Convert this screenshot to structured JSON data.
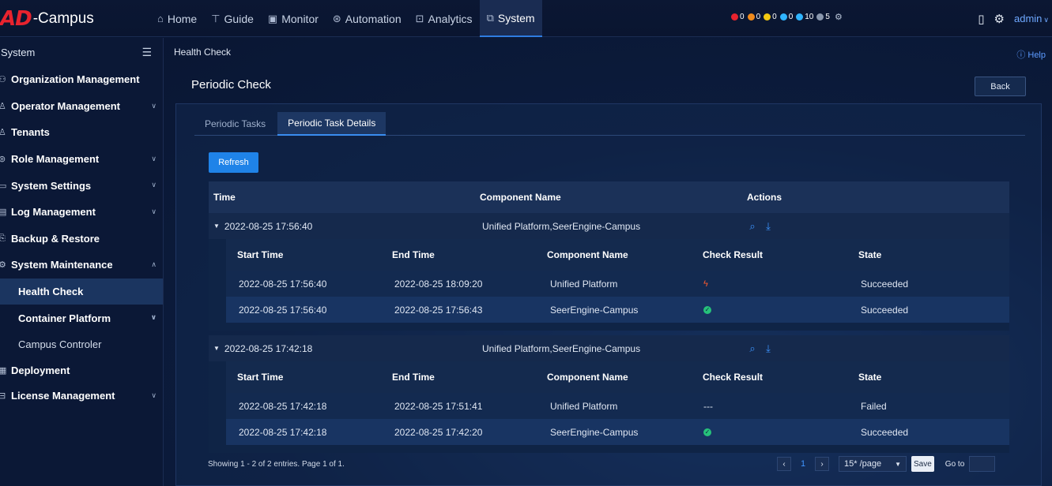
{
  "app": {
    "logo_ad": "AD",
    "logo_campus": "-Campus"
  },
  "nav": [
    {
      "label": "Home",
      "icon": "home-icon"
    },
    {
      "label": "Guide",
      "icon": "guide-icon"
    },
    {
      "label": "Monitor",
      "icon": "monitor-icon"
    },
    {
      "label": "Automation",
      "icon": "automation-icon"
    },
    {
      "label": "Analytics",
      "icon": "analytics-icon"
    },
    {
      "label": "System",
      "icon": "system-icon",
      "active": true
    }
  ],
  "alarms": [
    {
      "color": "#e8232e",
      "value": "0"
    },
    {
      "color": "#f08a1c",
      "value": "0"
    },
    {
      "color": "#f2c811",
      "value": "0"
    },
    {
      "color": "#2fb4ff",
      "value": "0"
    },
    {
      "color": "#2fb4ff",
      "value": "10"
    },
    {
      "color": "#8a97ad",
      "value": "5"
    }
  ],
  "user": {
    "name": "admin"
  },
  "sidebar": {
    "header": "System",
    "items": [
      {
        "label": "Organization Management"
      },
      {
        "label": "Operator Management"
      },
      {
        "label": "Tenants"
      },
      {
        "label": "Role Management"
      },
      {
        "label": "System Settings"
      },
      {
        "label": "Log Management"
      },
      {
        "label": "Backup & Restore"
      },
      {
        "label": "System Maintenance"
      }
    ],
    "sub_items": [
      {
        "label": "Health Check"
      },
      {
        "label": "Container Platform"
      },
      {
        "label": "Campus Controler"
      }
    ],
    "tail_items": [
      {
        "label": "Deployment"
      },
      {
        "label": "License Management"
      }
    ]
  },
  "breadcrumb": "Health Check",
  "help_label": "Help",
  "page_title": "Periodic Check",
  "back_label": "Back",
  "tabs": [
    {
      "label": "Periodic Tasks"
    },
    {
      "label": "Periodic Task Details"
    }
  ],
  "refresh_label": "Refresh",
  "table": {
    "headers": {
      "time": "Time",
      "component": "Component Name",
      "actions": "Actions"
    },
    "sub_headers": {
      "start": "Start Time",
      "end": "End Time",
      "component": "Component Name",
      "result": "Check Result",
      "state": "State"
    },
    "groups": [
      {
        "time": "2022-08-25 17:56:40",
        "component": "Unified Platform,SeerEngine-Campus",
        "rows": [
          {
            "start": "2022-08-25 17:56:40",
            "end": "2022-08-25 18:09:20",
            "component": "Unified Platform",
            "result": "warning",
            "state": "Succeeded"
          },
          {
            "start": "2022-08-25 17:56:40",
            "end": "2022-08-25 17:56:43",
            "component": "SeerEngine-Campus",
            "result": "ok",
            "state": "Succeeded"
          }
        ]
      },
      {
        "time": "2022-08-25 17:42:18",
        "component": "Unified Platform,SeerEngine-Campus",
        "rows": [
          {
            "start": "2022-08-25 17:42:18",
            "end": "2022-08-25 17:51:41",
            "component": "Unified Platform",
            "result": "---",
            "state": "Failed"
          },
          {
            "start": "2022-08-25 17:42:18",
            "end": "2022-08-25 17:42:20",
            "component": "SeerEngine-Campus",
            "result": "ok",
            "state": "Succeeded"
          }
        ]
      }
    ]
  },
  "footer": {
    "info": "Showing 1 - 2 of 2 entries. Page 1 of 1.",
    "page": "1",
    "page_size": "15* /page",
    "save_label": "Save",
    "goto_label": "Go to"
  }
}
